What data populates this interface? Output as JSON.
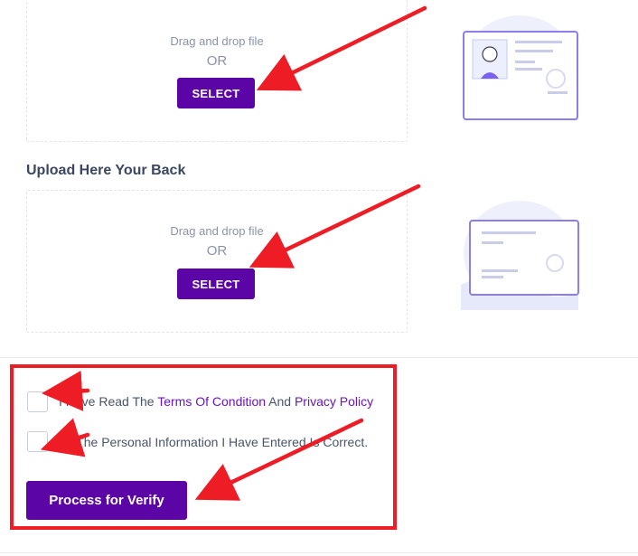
{
  "front_upload": {
    "drag_text": "Drag and drop file",
    "or_text": "OR",
    "select_label": "SELECT"
  },
  "back_upload": {
    "title": "Upload Here Your Back",
    "drag_text": "Drag and drop file",
    "or_text": "OR",
    "select_label": "SELECT"
  },
  "agreement": {
    "terms_prefix": "I Have Read The ",
    "terms_link": "Terms Of Condition",
    "terms_middle": " And ",
    "privacy_link": "Privacy Policy",
    "info_text": "All The Personal Information I Have Entered Is Correct."
  },
  "verify_button": "Process for Verify",
  "colors": {
    "accent": "#5b05a7",
    "link": "#6a12c6",
    "annotation": "#ee1c25",
    "illustration_line": "#8b7cf0"
  },
  "icons": [
    "id-card-front-illustration",
    "id-card-back-illustration",
    "annotation-arrow"
  ]
}
